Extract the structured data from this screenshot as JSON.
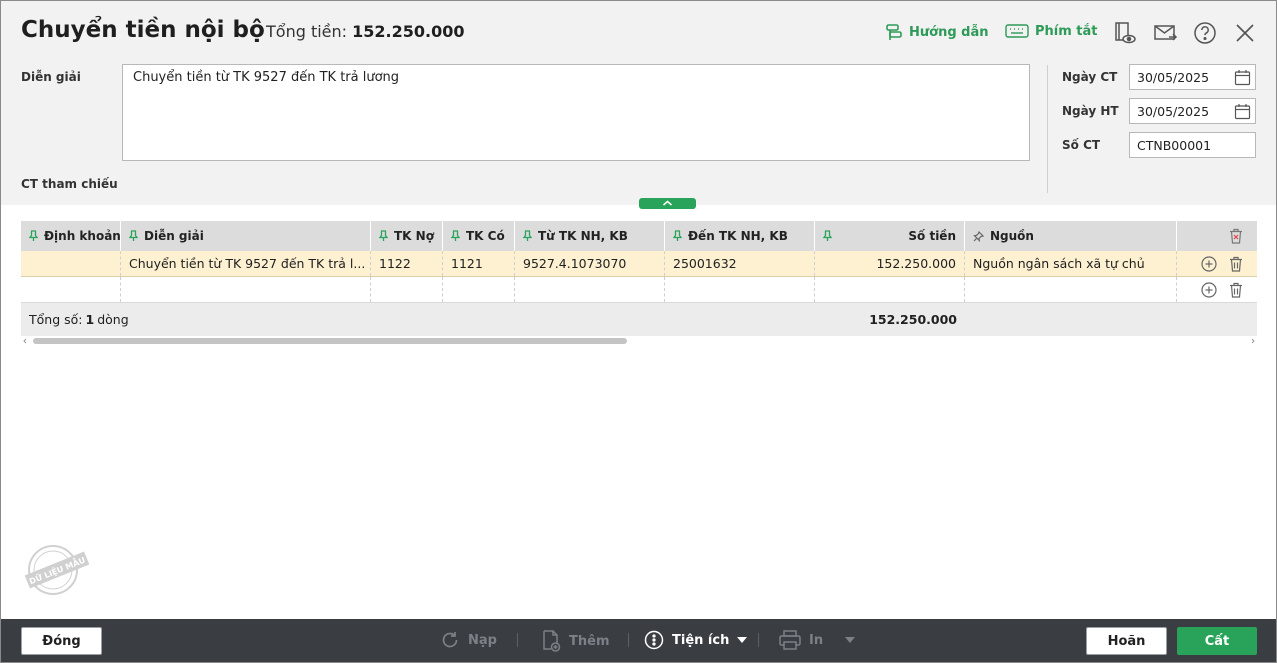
{
  "header": {
    "title": "Chuyển tiền nội bộ",
    "total_label": "Tổng tiền:",
    "total_value": "152.250.000",
    "guide_label": "Hướng dẫn",
    "shortcut_label": "Phím tắt"
  },
  "form": {
    "description_label": "Diễn giải",
    "description_value": "Chuyển tiền từ TK 9527 đến TK trả lương",
    "reference_label": "CT tham chiếu",
    "doc_date_label": "Ngày CT",
    "doc_date_value": "30/05/2025",
    "post_date_label": "Ngày HT",
    "post_date_value": "30/05/2025",
    "doc_no_label": "Số CT",
    "doc_no_value": "CTNB00001"
  },
  "grid": {
    "columns": [
      "Định khoản",
      "Diễn giải",
      "TK Nợ",
      "TK Có",
      "Từ TK NH, KB",
      "Đến TK NH, KB",
      "Số tiền",
      "Nguồn"
    ],
    "rows": [
      {
        "entry": "",
        "description": "Chuyển tiền từ TK 9527 đến TK trả l...",
        "debit": "1122",
        "credit": "1121",
        "from_account": "9527.4.1073070",
        "to_account": "25001632",
        "amount": "152.250.000",
        "source": "Nguồn ngân sách xã tự chủ"
      }
    ],
    "footer_prefix": "Tổng số: ",
    "footer_count": "1",
    "footer_suffix": " dòng",
    "footer_total": "152.250.000"
  },
  "watermark_text": "DỮ LIỆU MẪU",
  "toolbar": {
    "close_label": "Đóng",
    "reload_label": "Nạp",
    "add_label": "Thêm",
    "utility_label": "Tiện ích",
    "print_label": "In",
    "undo_label": "Hoãn",
    "save_label": "Cất"
  },
  "colors": {
    "accent_green": "#2aa35a",
    "header_bg": "#f2f2f2",
    "selected_row_bg": "#fdf1d2",
    "toolbar_bg": "#3a3d42"
  }
}
